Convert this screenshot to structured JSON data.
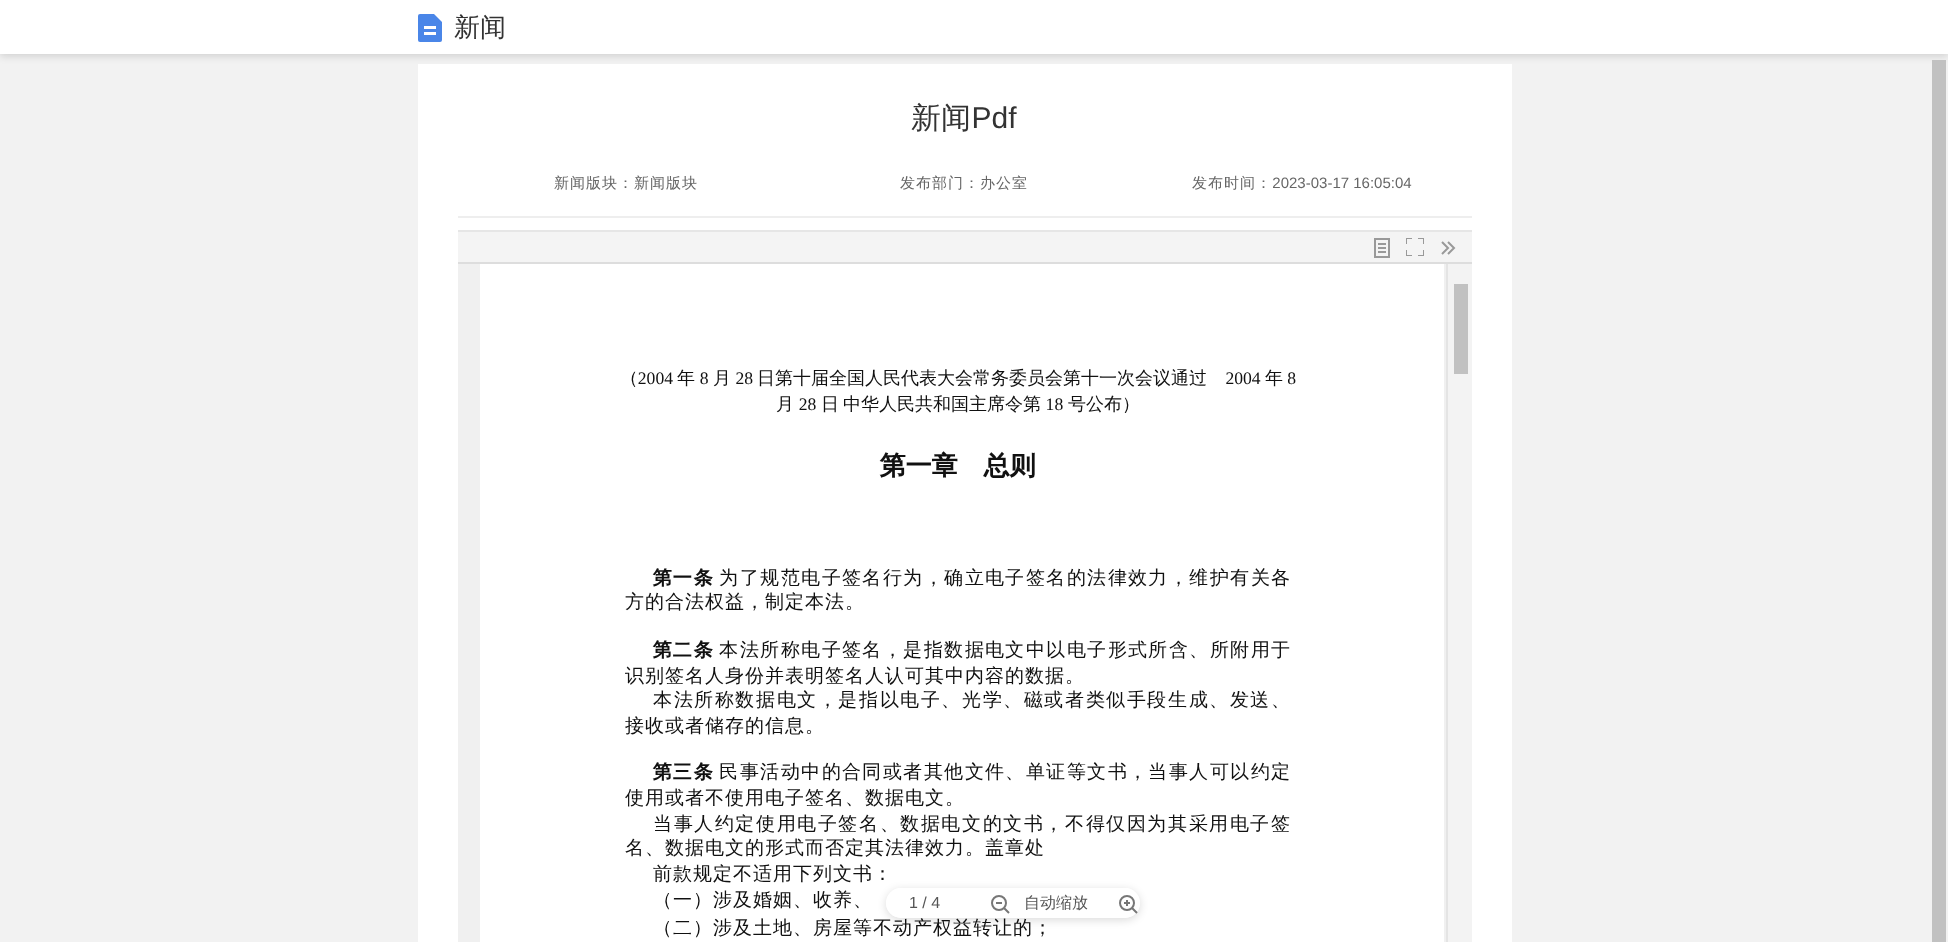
{
  "header": {
    "title": "新闻"
  },
  "article": {
    "title": "新闻Pdf",
    "meta": [
      "新闻版块：新闻版块",
      "发布部门：办公室",
      "发布时间：2023-03-17 16:05:04"
    ]
  },
  "pdf": {
    "preamble": "（2004 年 8 月 28 日第十届全国人民代表大会常务委员会第十一次会议通过　2004 年 8 月 28 日 中华人民共和国主席令第 18 号公布）",
    "chapter": "第一章　总则",
    "paragraphs": [
      {
        "kind": "article",
        "text": "**第一条** 为了规范电子签名行为，确立电子签名的法律效力，维护有关各方的合法权益，制定本法。"
      },
      {
        "kind": "article",
        "text": "**第二条** 本法所称电子签名，是指数据电文中以电子形式所含、所附用于识别签名人身份并表明签名人认可其中内容的数据。"
      },
      {
        "kind": "body",
        "text": "本法所称数据电文，是指以电子、光学、磁或者类似手段生成、发送、接收或者储存的信息。"
      },
      {
        "kind": "article",
        "text": "**第三条** 民事活动中的合同或者其他文件、单证等文书，当事人可以约定使用或者不使用电子签名、数据电文。"
      },
      {
        "kind": "body",
        "text": "当事人约定使用电子签名、数据电文的文书，不得仅因为其采用电子签名、数据电文的形式而否定其法律效力。盖章处"
      },
      {
        "kind": "body",
        "text": "前款规定不适用下列文书："
      },
      {
        "kind": "item",
        "text": "（一）涉及婚姻、收养、"
      },
      {
        "kind": "item",
        "text": "（二）涉及土地、房屋等不动产权益转让的；"
      }
    ],
    "page_indicator": "1 / 4",
    "zoom_label": "自动缩放"
  }
}
